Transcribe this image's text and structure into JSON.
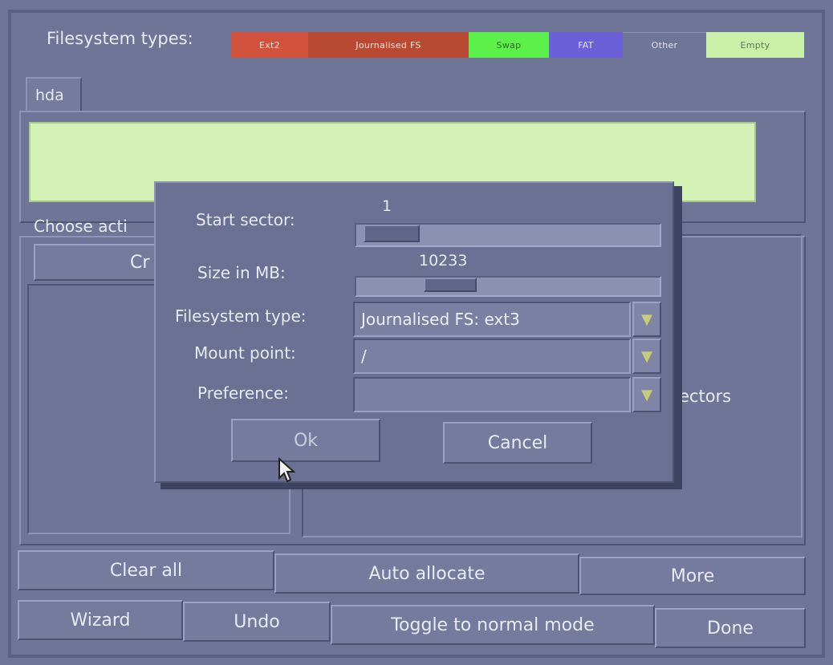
{
  "header": {
    "fs_types_label": "Filesystem types:",
    "legend": [
      {
        "label": "Ext2",
        "color": "#d0523c"
      },
      {
        "label": "Journalised FS",
        "color": "#b84a34"
      },
      {
        "label": "Swap",
        "color": "#5ef04a"
      },
      {
        "label": "FAT",
        "color": "#6c60d8"
      },
      {
        "label": "Other",
        "color": "#6e7596"
      },
      {
        "label": "Empty",
        "color": "#c8f0a8"
      }
    ]
  },
  "disk_tab": "hda",
  "disk_bar_color": "#d4f2b6",
  "choose_action_label": "Choose acti",
  "create_button_partial": "Cr",
  "sectors_partial": "ectors",
  "dialog": {
    "start_sector_label": "Start sector:",
    "start_sector_value": "1",
    "start_sector_fraction": 0.03,
    "size_label": "Size in MB:",
    "size_value": "10233",
    "size_fraction": 0.27,
    "fs_type_label": "Filesystem type:",
    "fs_type_value": "Journalised FS: ext3",
    "mount_label": "Mount point:",
    "mount_value": "/",
    "pref_label": "Preference:",
    "pref_value": "",
    "ok_label": "Ok",
    "cancel_label": "Cancel"
  },
  "bottom": {
    "clear_all": "Clear all",
    "auto_allocate": "Auto allocate",
    "more": "More",
    "wizard": "Wizard",
    "undo": "Undo",
    "toggle": "Toggle to normal mode",
    "done": "Done"
  }
}
